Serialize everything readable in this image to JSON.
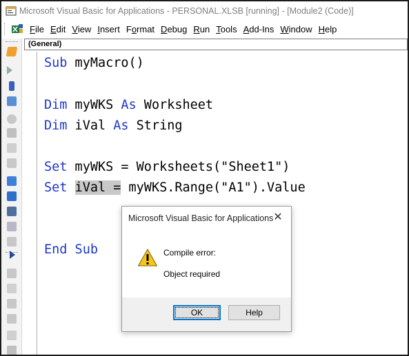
{
  "window": {
    "title": "Microsoft Visual Basic for Applications - PERSONAL.XLSB [running] - [Module2 (Code)]"
  },
  "menu": {
    "items": [
      {
        "label": "File",
        "access_key": "F"
      },
      {
        "label": "Edit",
        "access_key": "E"
      },
      {
        "label": "View",
        "access_key": "V"
      },
      {
        "label": "Insert",
        "access_key": "I"
      },
      {
        "label": "Format",
        "access_key": "o"
      },
      {
        "label": "Debug",
        "access_key": "D"
      },
      {
        "label": "Run",
        "access_key": "R"
      },
      {
        "label": "Tools",
        "access_key": "T"
      },
      {
        "label": "Add-Ins",
        "access_key": "A"
      },
      {
        "label": "Window",
        "access_key": "W"
      },
      {
        "label": "Help",
        "access_key": "H"
      }
    ]
  },
  "code_window": {
    "object_combo": "(General)",
    "lines": {
      "sub_kw": "Sub",
      "sub_name": " myMacro()",
      "dim1_kw": "Dim",
      "dim1_var": " myWKS ",
      "dim1_as": "As",
      "dim1_type": " Worksheet",
      "dim2_kw": "Dim",
      "dim2_var": " iVal ",
      "dim2_as": "As",
      "dim2_type": " String",
      "set1_kw": "Set",
      "set1_rest": " myWKS = Worksheets(\"Sheet1\")",
      "set2_kw": "Set",
      "set2_sel": "iVal =",
      "set2_rest": " myWKS.Range(\"A1\").Value",
      "end_sub": "End Sub"
    }
  },
  "dialog": {
    "title": "Microsoft Visual Basic for Applications",
    "message_line1": "Compile error:",
    "message_line2": "Object required",
    "ok_label": "OK",
    "help_label": "Help",
    "close_glyph": "✕",
    "icon": "warning-icon"
  },
  "colors": {
    "keyword": "#1f37c8",
    "selection": "#c8c8c8",
    "title_text": "#7f7f7f",
    "ok_focus_border": "#0078d7",
    "warning_fill": "#f5c518"
  }
}
